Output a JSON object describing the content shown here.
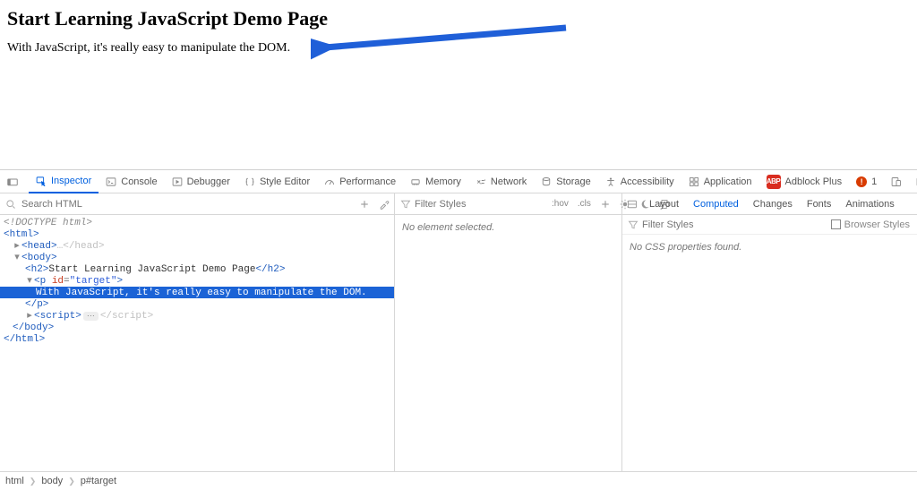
{
  "page": {
    "heading": "Start Learning JavaScript Demo Page",
    "paragraph": "With JavaScript, it's really easy to manipulate the DOM."
  },
  "tabs": {
    "inspector": "Inspector",
    "console": "Console",
    "debugger": "Debugger",
    "style_editor": "Style Editor",
    "performance": "Performance",
    "memory": "Memory",
    "network": "Network",
    "storage": "Storage",
    "accessibility": "Accessibility",
    "application": "Application",
    "adblock": "Adblock Plus"
  },
  "adblock_badge": "ABP",
  "warn_count": "1",
  "search_html_placeholder": "Search HTML",
  "filter_styles_placeholder": "Filter Styles",
  "mid_toolbar": {
    "hov": ":hov",
    "cls": ".cls"
  },
  "right_tabs": {
    "layout": "Layout",
    "computed": "Computed",
    "changes": "Changes",
    "fonts": "Fonts",
    "animations": "Animations"
  },
  "browser_styles_label": "Browser Styles",
  "mid_message": "No element selected.",
  "right_message": "No CSS properties found.",
  "dom": {
    "doctype": "<!DOCTYPE html>",
    "html_open": "<html>",
    "head": "<head>…</head>",
    "body_open": "<body>",
    "h2": {
      "open": "<h2>",
      "text": "Start Learning JavaScript Demo Page",
      "close": "</h2>"
    },
    "p_open": "<p id=\"target\">",
    "p_text": "With JavaScript, it's really easy to manipulate the DOM.",
    "p_close": "</p>",
    "script": {
      "open": "<script>",
      "close": "</script>"
    },
    "body_close": "</body>",
    "html_close": "</html>"
  },
  "breadcrumb": {
    "a": "html",
    "b": "body",
    "c": "p#target"
  }
}
